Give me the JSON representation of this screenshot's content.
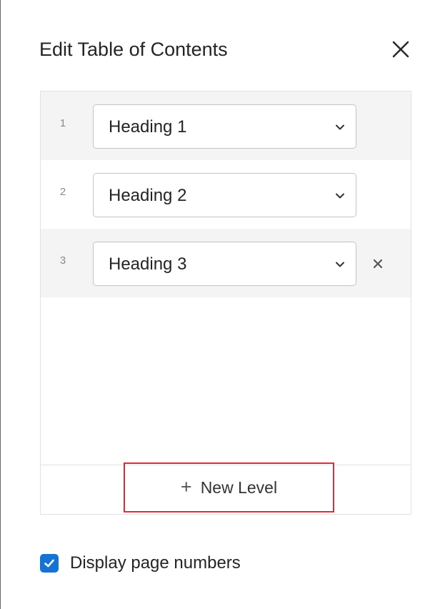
{
  "dialog": {
    "title": "Edit Table of Contents",
    "close_icon": "close-icon"
  },
  "levels": [
    {
      "number": "1",
      "value": "Heading 1",
      "removable": false
    },
    {
      "number": "2",
      "value": "Heading 2",
      "removable": false
    },
    {
      "number": "3",
      "value": "Heading 3",
      "removable": true
    }
  ],
  "new_level": {
    "icon": "plus-icon",
    "label": "New Level"
  },
  "display_page_numbers": {
    "label": "Display page numbers",
    "checked": true
  },
  "colors": {
    "accent": "#1673d4",
    "highlight_border": "#dd2b3a",
    "row_shade": "#f4f4f4"
  }
}
